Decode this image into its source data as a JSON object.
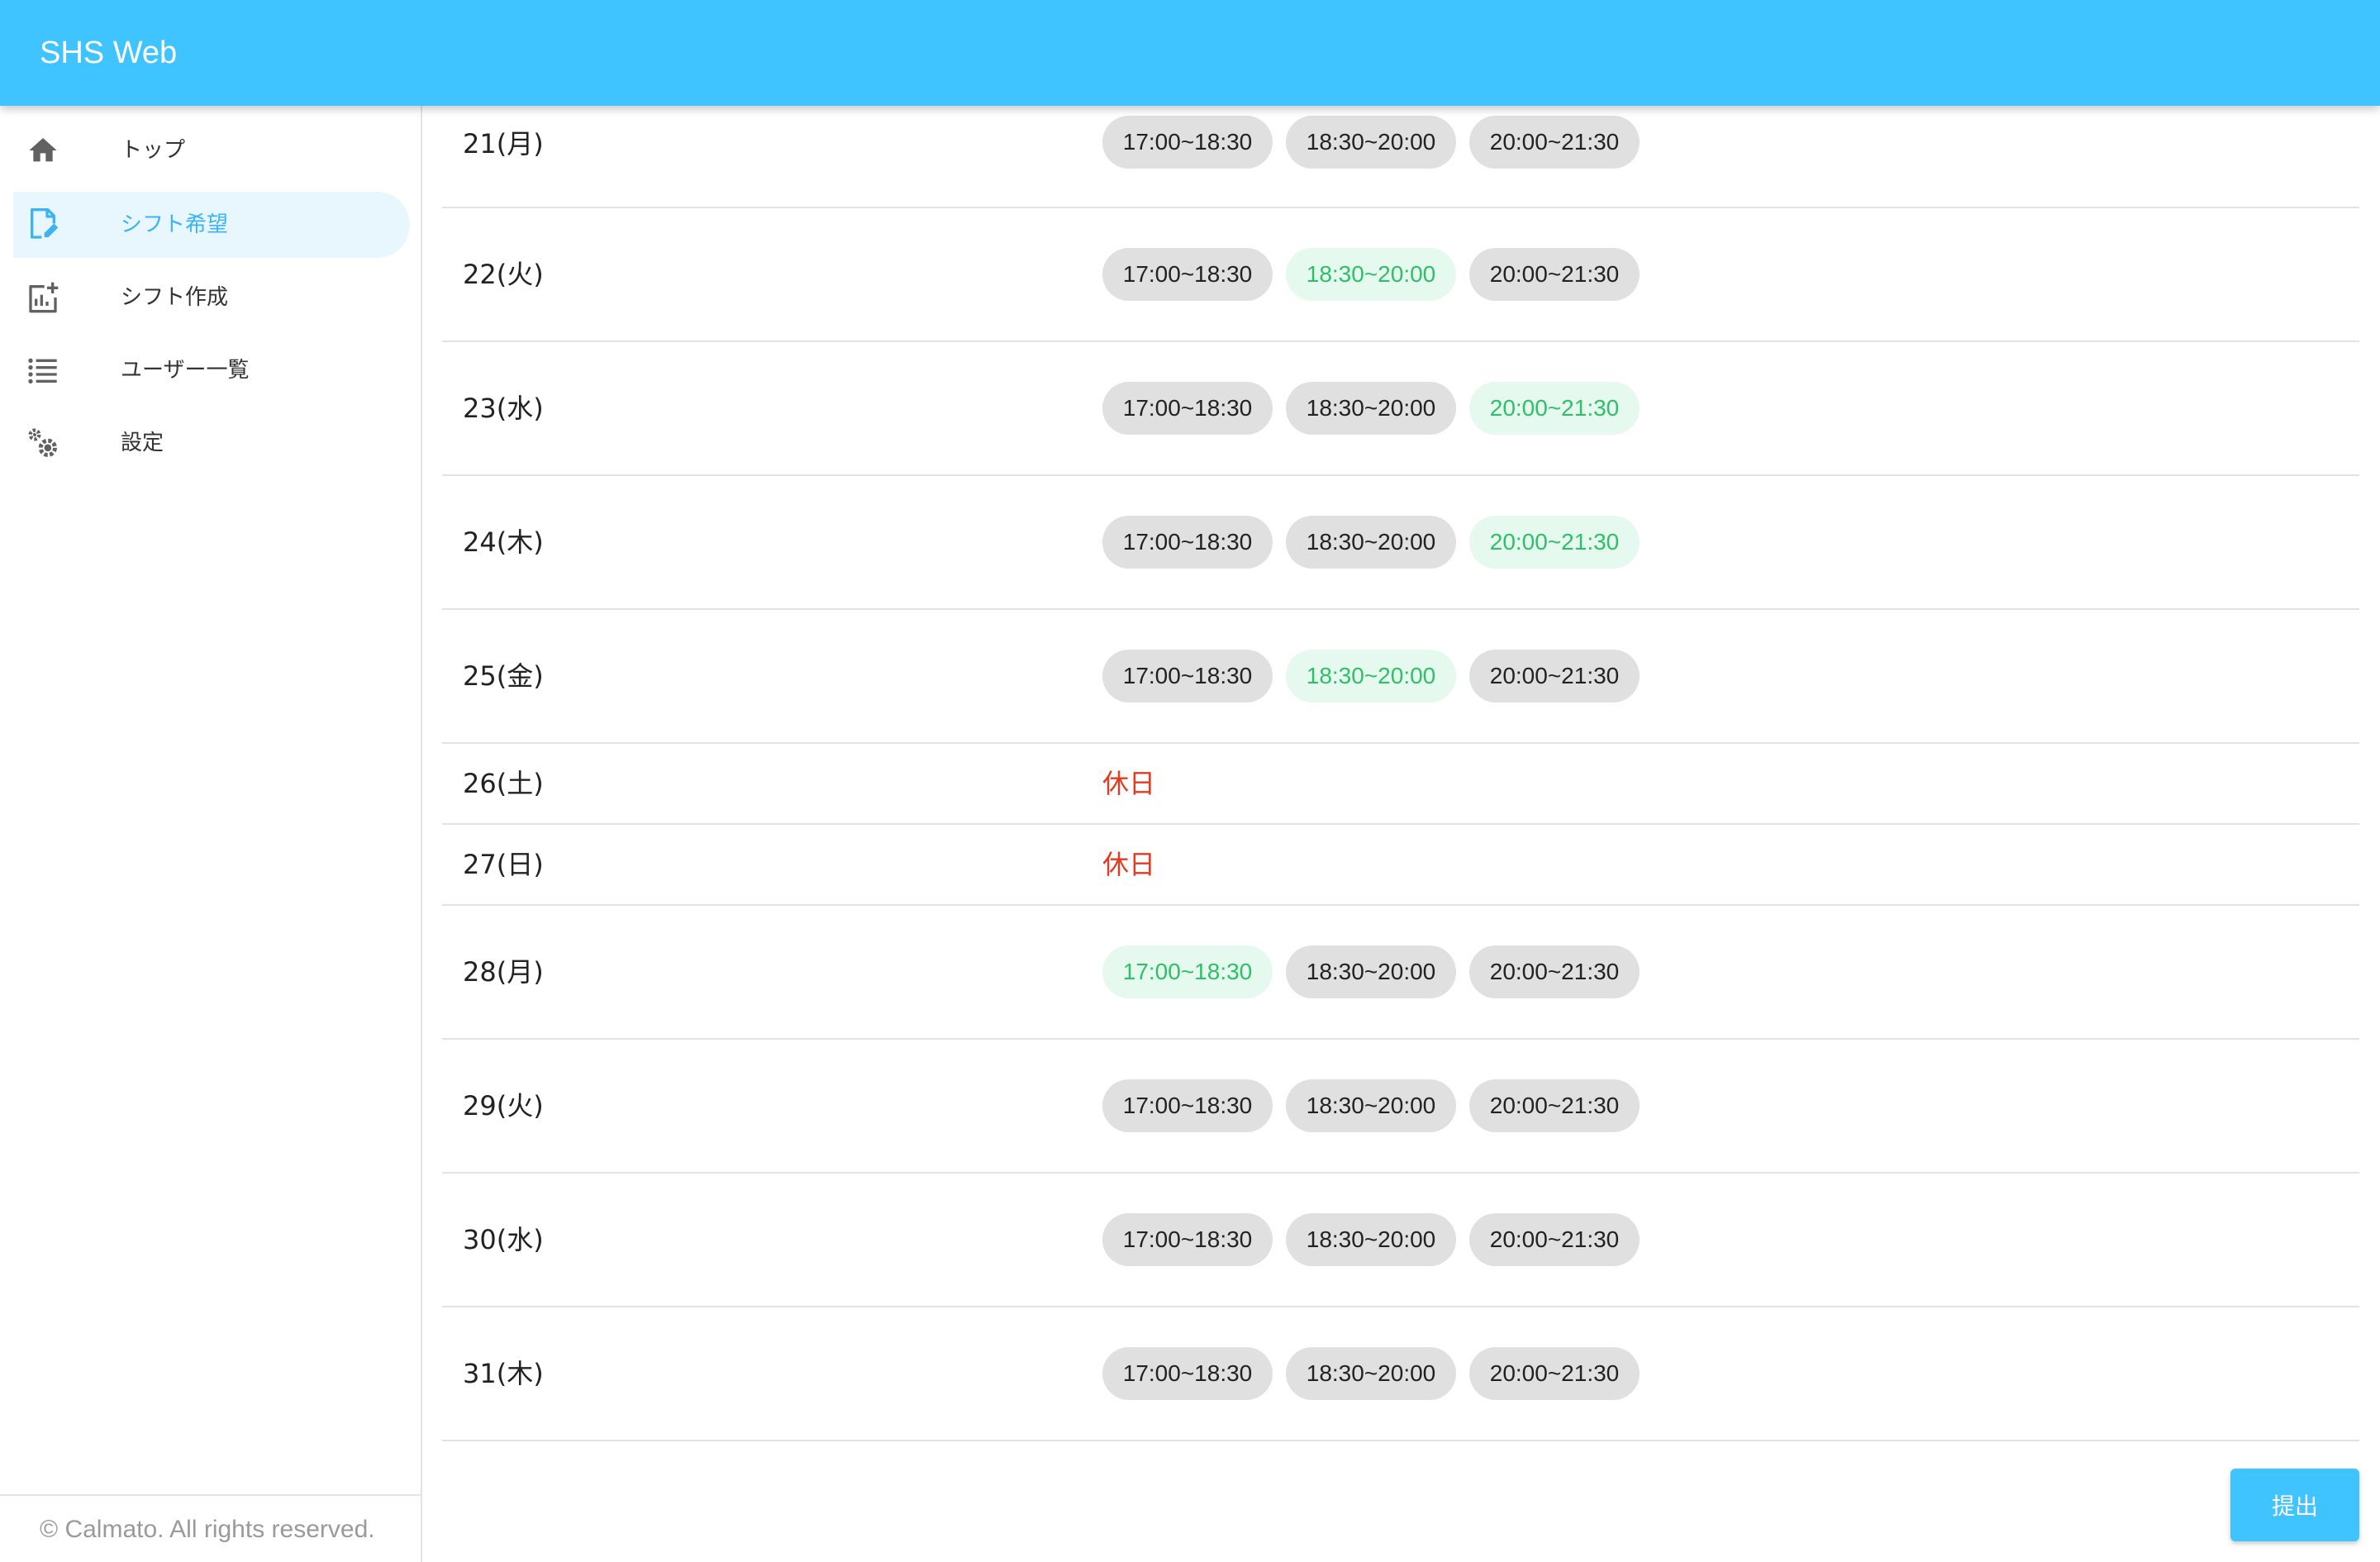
{
  "app": {
    "title": "SHS Web"
  },
  "sidebar": {
    "items": [
      {
        "label": "トップ",
        "icon": "home-icon",
        "active": false
      },
      {
        "label": "シフト希望",
        "icon": "edit-note-icon",
        "active": true
      },
      {
        "label": "シフト作成",
        "icon": "add-chart-icon",
        "active": false
      },
      {
        "label": "ユーザー一覧",
        "icon": "list-icon",
        "active": false
      },
      {
        "label": "設定",
        "icon": "settings-gears-icon",
        "active": false
      }
    ],
    "footer": "© Calmato. All rights reserved."
  },
  "schedule": {
    "days": [
      {
        "date": "21(月)",
        "slots": [
          {
            "time": "17:00~18:30",
            "selected": false
          },
          {
            "time": "18:30~20:00",
            "selected": false
          },
          {
            "time": "20:00~21:30",
            "selected": false
          }
        ]
      },
      {
        "date": "22(火)",
        "slots": [
          {
            "time": "17:00~18:30",
            "selected": false
          },
          {
            "time": "18:30~20:00",
            "selected": true
          },
          {
            "time": "20:00~21:30",
            "selected": false
          }
        ]
      },
      {
        "date": "23(水)",
        "slots": [
          {
            "time": "17:00~18:30",
            "selected": false
          },
          {
            "time": "18:30~20:00",
            "selected": false
          },
          {
            "time": "20:00~21:30",
            "selected": true
          }
        ]
      },
      {
        "date": "24(木)",
        "slots": [
          {
            "time": "17:00~18:30",
            "selected": false
          },
          {
            "time": "18:30~20:00",
            "selected": false
          },
          {
            "time": "20:00~21:30",
            "selected": true
          }
        ]
      },
      {
        "date": "25(金)",
        "slots": [
          {
            "time": "17:00~18:30",
            "selected": false
          },
          {
            "time": "18:30~20:00",
            "selected": true
          },
          {
            "time": "20:00~21:30",
            "selected": false
          }
        ]
      },
      {
        "date": "26(土)",
        "holiday": "休日"
      },
      {
        "date": "27(日)",
        "holiday": "休日"
      },
      {
        "date": "28(月)",
        "slots": [
          {
            "time": "17:00~18:30",
            "selected": true
          },
          {
            "time": "18:30~20:00",
            "selected": false
          },
          {
            "time": "20:00~21:30",
            "selected": false
          }
        ]
      },
      {
        "date": "29(火)",
        "slots": [
          {
            "time": "17:00~18:30",
            "selected": false
          },
          {
            "time": "18:30~20:00",
            "selected": false
          },
          {
            "time": "20:00~21:30",
            "selected": false
          }
        ]
      },
      {
        "date": "30(水)",
        "slots": [
          {
            "time": "17:00~18:30",
            "selected": false
          },
          {
            "time": "18:30~20:00",
            "selected": false
          },
          {
            "time": "20:00~21:30",
            "selected": false
          }
        ]
      },
      {
        "date": "31(木)",
        "slots": [
          {
            "time": "17:00~18:30",
            "selected": false
          },
          {
            "time": "18:30~20:00",
            "selected": false
          },
          {
            "time": "20:00~21:30",
            "selected": false
          }
        ]
      }
    ],
    "submit_label": "提出"
  },
  "colors": {
    "accent": "#40c4ff",
    "selected_text": "#2fbf69",
    "selected_bg": "#e6f9ee",
    "chip_bg": "#e0e0e0",
    "holiday": "#e53a1e",
    "active_nav_bg": "#e8f6fe",
    "active_nav_text": "#3bb3f5"
  }
}
